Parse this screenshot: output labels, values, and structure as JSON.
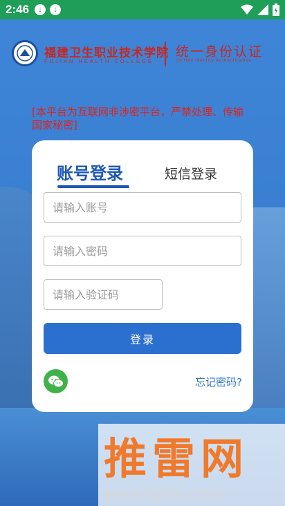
{
  "status_bar": {
    "time": "2:46",
    "icons": [
      "download-icon",
      "download-icon",
      "wifi-icon",
      "signal-icon",
      "battery-icon"
    ]
  },
  "header": {
    "school_name_cn": "福建卫生职业技术学院",
    "school_name_en": "FUJIAN  HEALTH  COLLEGE",
    "system_name_cn": "统一身份认证",
    "system_name_en": "Unified Identity Authentication"
  },
  "notice": "[本平台为互联网非涉密平台，严禁处理、传输国家秘密]",
  "login": {
    "tabs": [
      "账号登录",
      "短信登录"
    ],
    "active_tab": 0,
    "account_placeholder": "请输入账号",
    "password_placeholder": "请输入密码",
    "captcha_placeholder": "请输入验证码",
    "submit_label": "登录",
    "forgot_label": "忘记密码?"
  },
  "watermark": {
    "brand": "推雷网",
    "url": "www.tuilei.com"
  },
  "colors": {
    "status_bar": "#1e9e57",
    "accent": "#2b6fcf",
    "notice_red": "#e0211c",
    "school_red": "#c9261f",
    "wechat_green": "#3fb24a"
  }
}
